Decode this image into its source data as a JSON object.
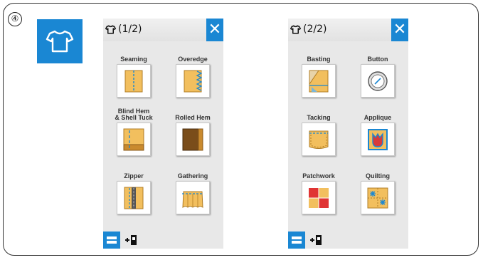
{
  "step_number": "④",
  "category_icon": "shirt-icon",
  "accent_color": "#1a87d3",
  "panels": [
    {
      "page_label": "(1/2)",
      "close_label": "✕",
      "items": [
        {
          "label": "Seaming",
          "icon": "seaming-icon"
        },
        {
          "label": "Overedge",
          "icon": "overedge-icon"
        },
        {
          "label": "Blind Hem\n& Shell Tuck",
          "icon": "blind-hem-icon"
        },
        {
          "label": "Rolled Hem",
          "icon": "rolled-hem-icon"
        },
        {
          "label": "Zipper",
          "icon": "zipper-icon"
        },
        {
          "label": "Gathering",
          "icon": "gathering-icon"
        }
      ]
    },
    {
      "page_label": "(2/2)",
      "close_label": "✕",
      "items": [
        {
          "label": "Basting",
          "icon": "basting-icon"
        },
        {
          "label": "Button",
          "icon": "button-icon"
        },
        {
          "label": "Tacking",
          "icon": "tacking-icon"
        },
        {
          "label": "Applique",
          "icon": "applique-icon"
        },
        {
          "label": "Patchwork",
          "icon": "patchwork-icon"
        },
        {
          "label": "Quilting",
          "icon": "quilting-icon"
        }
      ]
    }
  ]
}
